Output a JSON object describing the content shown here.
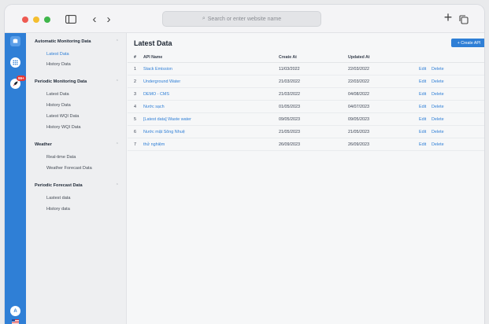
{
  "browser": {
    "url_placeholder": "Search or enter website name"
  },
  "rail": {
    "badge": "99+",
    "user_initial": "A"
  },
  "sidebar": {
    "groups": [
      {
        "title": "Automatic Monitoring Data",
        "items": [
          "Latest Data",
          "History Data"
        ]
      },
      {
        "title": "Periodic Monitoring Data",
        "items": [
          "Latest Data",
          "History Data",
          "Latest WQI Data",
          "History WQI Data"
        ]
      },
      {
        "title": "Weather",
        "items": [
          "Real-time Data",
          "Weather Forecast Data"
        ]
      },
      {
        "title": "Periodic Forecast Data",
        "items": [
          "Lastest data",
          "History data"
        ]
      }
    ]
  },
  "main": {
    "title": "Latest Data",
    "create_label": "+ Create API",
    "columns": {
      "num": "#",
      "name": "API Name",
      "created": "Create At",
      "updated": "Updated At"
    },
    "rows": [
      {
        "num": "1",
        "name": "Stack Emission",
        "created": "11/03/2022",
        "updated": "22/03/2022",
        "edit": "Edit",
        "delete": "Delete"
      },
      {
        "num": "2",
        "name": "Underground Water",
        "created": "21/03/2022",
        "updated": "22/03/2022",
        "edit": "Edit",
        "delete": "Delete"
      },
      {
        "num": "3",
        "name": "DEMO - CMS",
        "created": "21/03/2022",
        "updated": "04/08/2022",
        "edit": "Edit",
        "delete": "Delete"
      },
      {
        "num": "4",
        "name": "Nước sạch",
        "created": "01/05/2023",
        "updated": "04/07/2023",
        "edit": "Edit",
        "delete": "Delete"
      },
      {
        "num": "5",
        "name": "[Latest data] Waste water",
        "created": "09/05/2023",
        "updated": "09/05/2023",
        "edit": "Edit",
        "delete": "Delete"
      },
      {
        "num": "6",
        "name": "Nước mặt Sông Nhuệ",
        "created": "21/05/2023",
        "updated": "21/05/2023",
        "edit": "Edit",
        "delete": "Delete"
      },
      {
        "num": "7",
        "name": "thử nghiệm",
        "created": "26/09/2023",
        "updated": "26/09/2023",
        "edit": "Edit",
        "delete": "Delete"
      }
    ]
  }
}
